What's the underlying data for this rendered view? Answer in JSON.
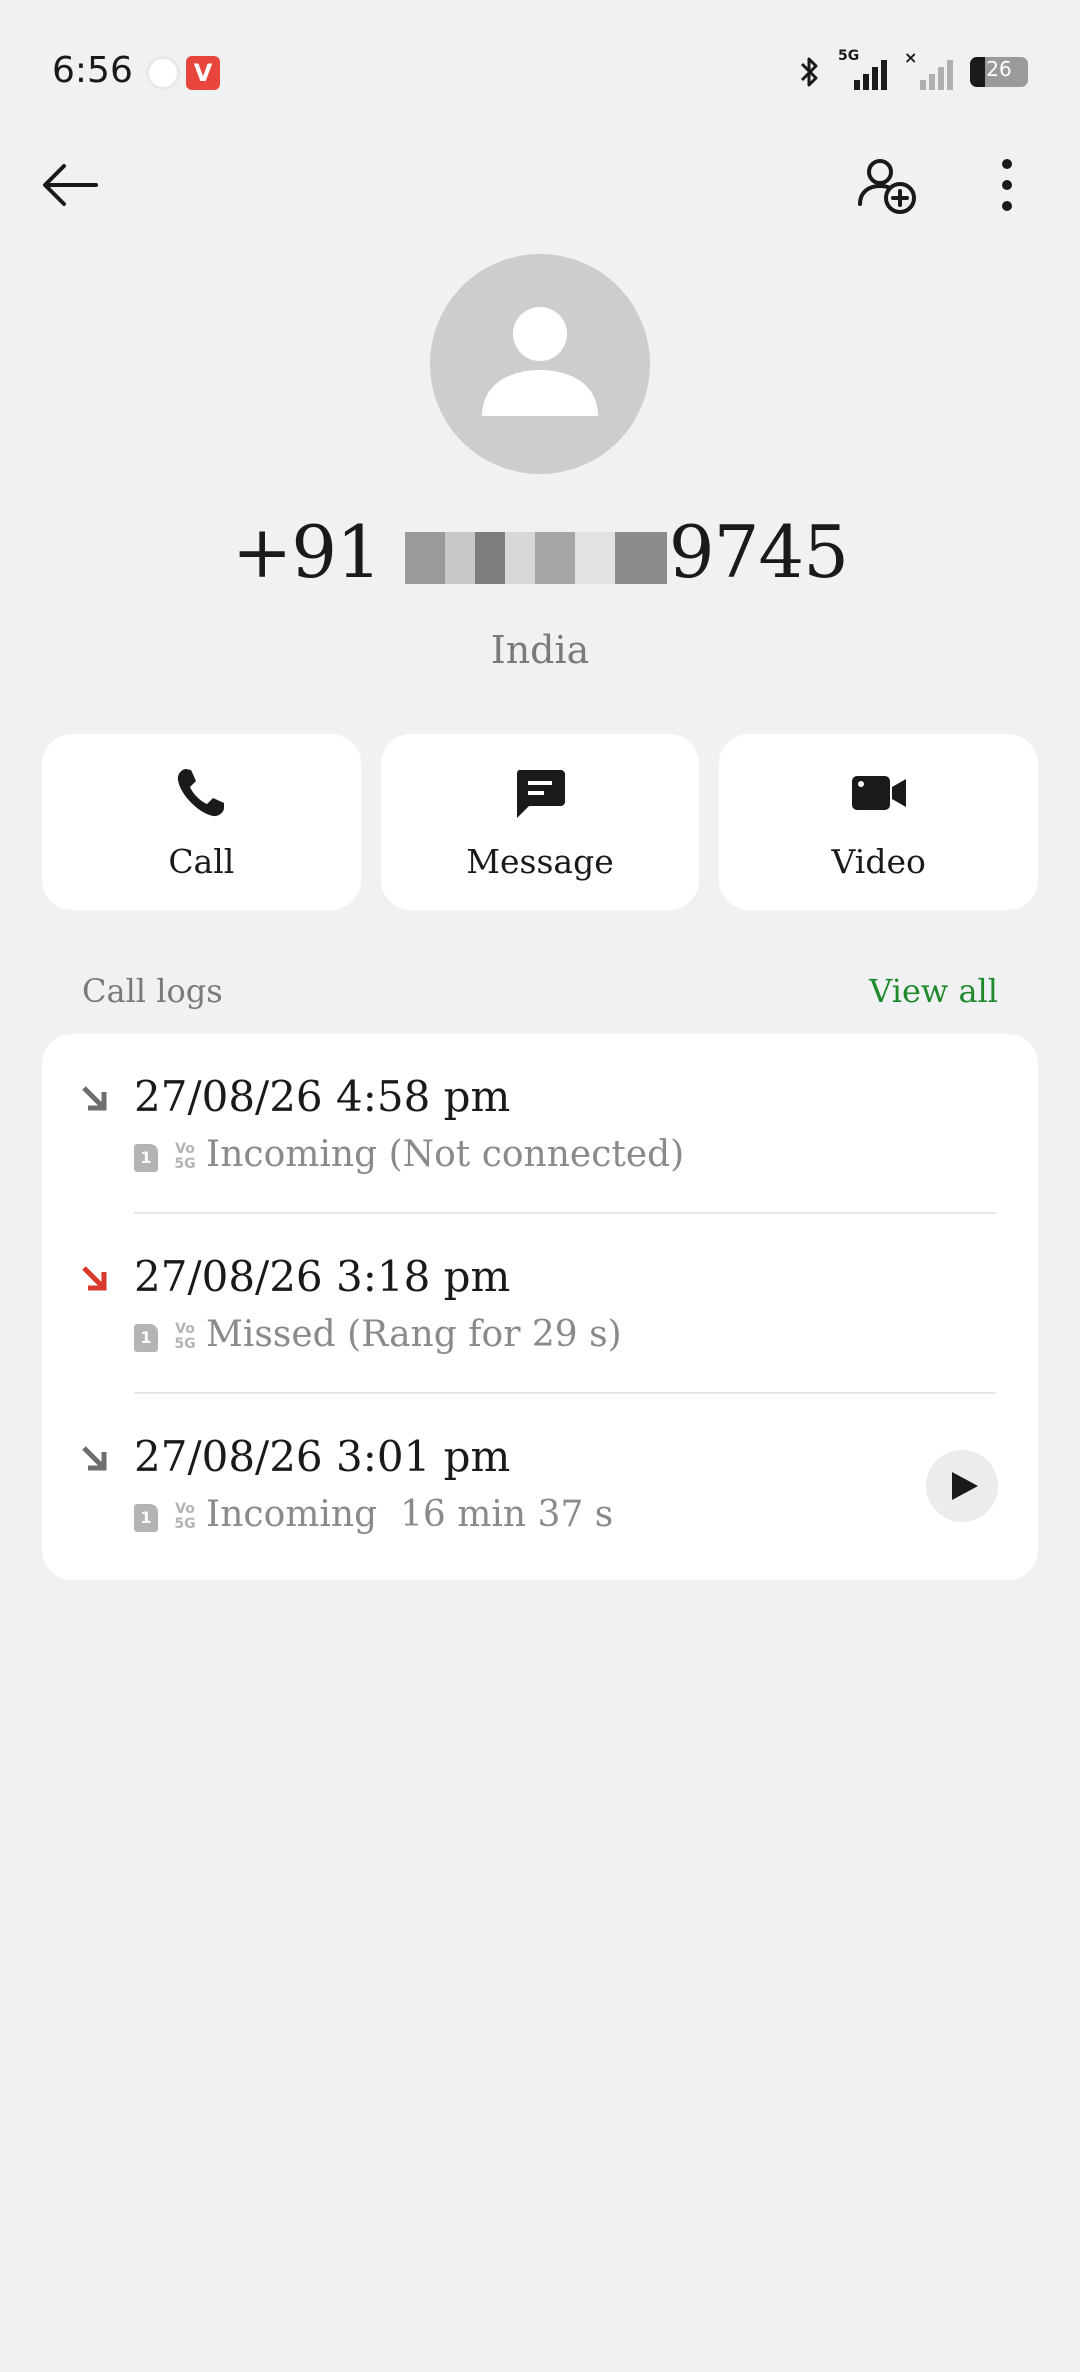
{
  "status_bar": {
    "time": "6:56",
    "network_label": "5G",
    "battery_level": "26"
  },
  "contact": {
    "phone_prefix": "+91 ",
    "phone_suffix": "9745",
    "country": "India"
  },
  "actions": [
    {
      "label": "Call",
      "icon": "phone-icon"
    },
    {
      "label": "Message",
      "icon": "message-icon"
    },
    {
      "label": "Video",
      "icon": "video-icon"
    }
  ],
  "call_logs": {
    "title": "Call logs",
    "view_all": "View all",
    "entries": [
      {
        "time": "27/08/26 4:58 pm",
        "sim": "1",
        "detail": "Incoming (Not connected)",
        "type": "incoming",
        "arrow_color": "#6e6e6e"
      },
      {
        "time": "27/08/26 3:18 pm",
        "sim": "1",
        "detail": "Missed (Rang for 29 s)",
        "type": "missed",
        "arrow_color": "#d83a2e"
      },
      {
        "time": "27/08/26 3:01 pm",
        "sim": "1",
        "detail": "Incoming  16 min 37 s",
        "type": "incoming",
        "arrow_color": "#6e6e6e",
        "has_recording": true
      }
    ]
  },
  "colors": {
    "background": "#f0f1f3",
    "card": "#ffffff",
    "accent_green": "#1e8a2c",
    "missed_red": "#d83a2e"
  }
}
